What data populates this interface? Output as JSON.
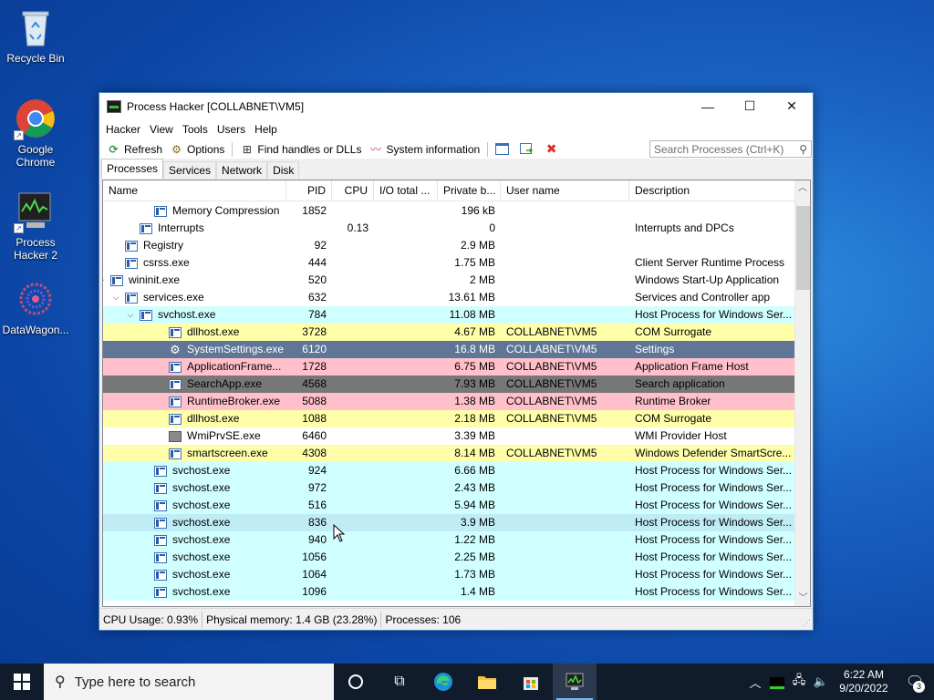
{
  "desktop": {
    "icons": [
      {
        "label": "Recycle Bin"
      },
      {
        "label": "Google Chrome"
      },
      {
        "label": "Process Hacker 2"
      },
      {
        "label": "DataWagon..."
      }
    ]
  },
  "window": {
    "title": "Process Hacker [COLLABNET\\VM5]",
    "controls": {
      "minimize": "—",
      "maximize": "☐",
      "close": "✕"
    },
    "menu": [
      "Hacker",
      "View",
      "Tools",
      "Users",
      "Help"
    ],
    "toolbar": {
      "refresh": "Refresh",
      "options": "Options",
      "find_handles": "Find handles or DLLs",
      "system_information": "System information",
      "search_placeholder": "Search Processes (Ctrl+K)"
    },
    "tabs": [
      "Processes",
      "Services",
      "Network",
      "Disk"
    ],
    "active_tab": "Processes",
    "columns": [
      "Name",
      "PID",
      "CPU",
      "I/O total ...",
      "Private b...",
      "User name",
      "Description"
    ],
    "rows": [
      {
        "name": "Memory Compression",
        "pid": "1852",
        "cpu": "",
        "io": "",
        "priv": "196 kB",
        "user": "",
        "desc": "",
        "indent": 3,
        "twisty": "",
        "icon": "proc",
        "bg": "white"
      },
      {
        "name": "Interrupts",
        "pid": "",
        "cpu": "0.13",
        "io": "",
        "priv": "0",
        "user": "",
        "desc": "Interrupts and DPCs",
        "indent": 2,
        "twisty": "",
        "icon": "proc",
        "bg": "white"
      },
      {
        "name": "Registry",
        "pid": "92",
        "cpu": "",
        "io": "",
        "priv": "2.9 MB",
        "user": "",
        "desc": "",
        "indent": 1,
        "twisty": "",
        "icon": "proc",
        "bg": "white"
      },
      {
        "name": "csrss.exe",
        "pid": "444",
        "cpu": "",
        "io": "",
        "priv": "1.75 MB",
        "user": "",
        "desc": "Client Server Runtime Process",
        "indent": 1,
        "twisty": "",
        "icon": "proc",
        "bg": "white"
      },
      {
        "name": "wininit.exe",
        "pid": "520",
        "cpu": "",
        "io": "",
        "priv": "2 MB",
        "user": "",
        "desc": "Windows Start-Up Application",
        "indent": 0,
        "twisty": "v",
        "icon": "proc",
        "bg": "white"
      },
      {
        "name": "services.exe",
        "pid": "632",
        "cpu": "",
        "io": "",
        "priv": "13.61 MB",
        "user": "",
        "desc": "Services and Controller app",
        "indent": 1,
        "twisty": "v",
        "icon": "proc",
        "bg": "white"
      },
      {
        "name": "svchost.exe",
        "pid": "784",
        "cpu": "",
        "io": "",
        "priv": "11.08 MB",
        "user": "",
        "desc": "Host Process for Windows Ser...",
        "indent": 2,
        "twisty": "v",
        "icon": "proc",
        "bg": "cyan"
      },
      {
        "name": "dllhost.exe",
        "pid": "3728",
        "cpu": "",
        "io": "",
        "priv": "4.67 MB",
        "user": "COLLABNET\\VM5",
        "desc": "COM Surrogate",
        "indent": 4,
        "twisty": "",
        "icon": "proc",
        "bg": "yellow"
      },
      {
        "name": "SystemSettings.exe",
        "pid": "6120",
        "cpu": "",
        "io": "",
        "priv": "16.8 MB",
        "user": "COLLABNET\\VM5",
        "desc": "Settings",
        "indent": 4,
        "twisty": "",
        "icon": "gear",
        "bg": "slate"
      },
      {
        "name": "ApplicationFrame...",
        "pid": "1728",
        "cpu": "",
        "io": "",
        "priv": "6.75 MB",
        "user": "COLLABNET\\VM5",
        "desc": "Application Frame Host",
        "indent": 4,
        "twisty": "",
        "icon": "proc",
        "bg": "pink"
      },
      {
        "name": "SearchApp.exe",
        "pid": "4568",
        "cpu": "",
        "io": "",
        "priv": "7.93 MB",
        "user": "COLLABNET\\VM5",
        "desc": "Search application",
        "indent": 4,
        "twisty": "",
        "icon": "proc",
        "bg": "gray"
      },
      {
        "name": "RuntimeBroker.exe",
        "pid": "5088",
        "cpu": "",
        "io": "",
        "priv": "1.38 MB",
        "user": "COLLABNET\\VM5",
        "desc": "Runtime Broker",
        "indent": 4,
        "twisty": "",
        "icon": "proc",
        "bg": "pink"
      },
      {
        "name": "dllhost.exe",
        "pid": "1088",
        "cpu": "",
        "io": "",
        "priv": "2.18 MB",
        "user": "COLLABNET\\VM5",
        "desc": "COM Surrogate",
        "indent": 4,
        "twisty": "",
        "icon": "proc",
        "bg": "yellow"
      },
      {
        "name": "WmiPrvSE.exe",
        "pid": "6460",
        "cpu": "",
        "io": "",
        "priv": "3.39 MB",
        "user": "",
        "desc": "WMI Provider Host",
        "indent": 4,
        "twisty": "",
        "icon": "wmi",
        "bg": "white"
      },
      {
        "name": "smartscreen.exe",
        "pid": "4308",
        "cpu": "",
        "io": "",
        "priv": "8.14 MB",
        "user": "COLLABNET\\VM5",
        "desc": "Windows Defender SmartScre...",
        "indent": 4,
        "twisty": "",
        "icon": "proc",
        "bg": "yellow"
      },
      {
        "name": "svchost.exe",
        "pid": "924",
        "cpu": "",
        "io": "",
        "priv": "6.66 MB",
        "user": "",
        "desc": "Host Process for Windows Ser...",
        "indent": 3,
        "twisty": "",
        "icon": "proc",
        "bg": "cyan"
      },
      {
        "name": "svchost.exe",
        "pid": "972",
        "cpu": "",
        "io": "",
        "priv": "2.43 MB",
        "user": "",
        "desc": "Host Process for Windows Ser...",
        "indent": 3,
        "twisty": "",
        "icon": "proc",
        "bg": "cyan"
      },
      {
        "name": "svchost.exe",
        "pid": "516",
        "cpu": "",
        "io": "",
        "priv": "5.94 MB",
        "user": "",
        "desc": "Host Process for Windows Ser...",
        "indent": 3,
        "twisty": "",
        "icon": "proc",
        "bg": "cyan"
      },
      {
        "name": "svchost.exe",
        "pid": "836",
        "cpu": "",
        "io": "",
        "priv": "3.9 MB",
        "user": "",
        "desc": "Host Process for Windows Ser...",
        "indent": 3,
        "twisty": "",
        "icon": "proc",
        "bg": "cyan-hover"
      },
      {
        "name": "svchost.exe",
        "pid": "940",
        "cpu": "",
        "io": "",
        "priv": "1.22 MB",
        "user": "",
        "desc": "Host Process for Windows Ser...",
        "indent": 3,
        "twisty": "",
        "icon": "proc",
        "bg": "cyan"
      },
      {
        "name": "svchost.exe",
        "pid": "1056",
        "cpu": "",
        "io": "",
        "priv": "2.25 MB",
        "user": "",
        "desc": "Host Process for Windows Ser...",
        "indent": 3,
        "twisty": "",
        "icon": "proc",
        "bg": "cyan"
      },
      {
        "name": "svchost.exe",
        "pid": "1064",
        "cpu": "",
        "io": "",
        "priv": "1.73 MB",
        "user": "",
        "desc": "Host Process for Windows Ser...",
        "indent": 3,
        "twisty": "",
        "icon": "proc",
        "bg": "cyan"
      },
      {
        "name": "svchost.exe",
        "pid": "1096",
        "cpu": "",
        "io": "",
        "priv": "1.4 MB",
        "user": "",
        "desc": "Host Process for Windows Ser...",
        "indent": 3,
        "twisty": "",
        "icon": "proc",
        "bg": "cyan"
      }
    ],
    "status": {
      "cpu": "CPU Usage: 0.93%",
      "memory": "Physical memory: 1.4 GB (23.28%)",
      "processes": "Processes: 106"
    }
  },
  "taskbar": {
    "search_placeholder": "Type here to search",
    "clock_time": "6:22 AM",
    "clock_date": "9/20/2022",
    "notification_count": "3"
  }
}
